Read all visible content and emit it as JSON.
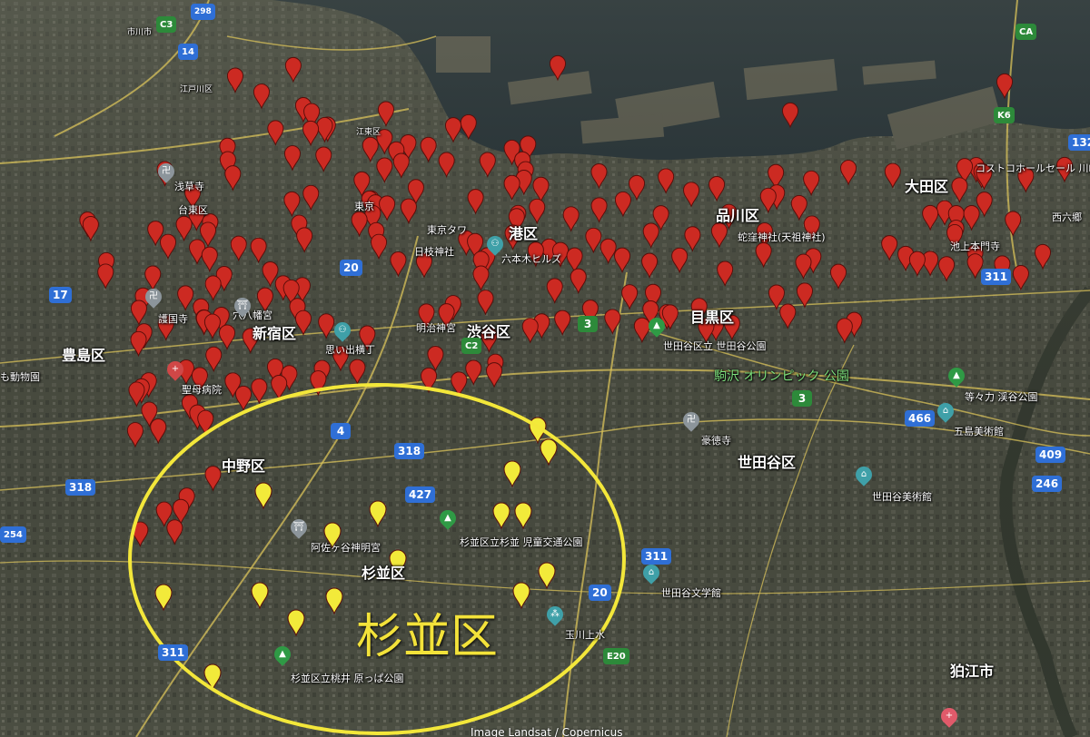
{
  "map": {
    "credit": "Image Landsat / Copernicus",
    "highlight_label": "杉並区",
    "colors": {
      "water": "#1d2b33",
      "land": "#4a4d40",
      "road": "#d8c25a",
      "red_pin": "#cc2a22",
      "yellow_pin": "#f2ea3a",
      "ellipse": "#f3e73a"
    }
  },
  "districts": [
    {
      "id": "toshima",
      "label": "豊島区"
    },
    {
      "id": "shinjuku",
      "label": "新宿区"
    },
    {
      "id": "shibuya",
      "label": "渋谷区"
    },
    {
      "id": "minato",
      "label": "港区"
    },
    {
      "id": "shinagawa",
      "label": "品川区"
    },
    {
      "id": "meguro",
      "label": "目黒区"
    },
    {
      "id": "ota",
      "label": "大田区"
    },
    {
      "id": "nakano",
      "label": "中野区"
    },
    {
      "id": "suginami",
      "label": "杉並区"
    },
    {
      "id": "setagaya",
      "label": "世田谷区"
    },
    {
      "id": "komae",
      "label": "狛江市"
    },
    {
      "id": "taito",
      "label": "台東区"
    }
  ],
  "pois": [
    {
      "id": "asakusa",
      "label": "浅草寺"
    },
    {
      "id": "tokyo",
      "label": "東京"
    },
    {
      "id": "tokyo-tower",
      "label": "東京タワ"
    },
    {
      "id": "hie",
      "label": "日枝神社"
    },
    {
      "id": "roppongi",
      "label": "六本木ヒルズ"
    },
    {
      "id": "gokokuji",
      "label": "護国寺"
    },
    {
      "id": "anahachiman",
      "label": "穴八幡宮"
    },
    {
      "id": "meiji",
      "label": "明治神宮"
    },
    {
      "id": "omoide",
      "label": "思い出横丁"
    },
    {
      "id": "seibo",
      "label": "聖母病院"
    },
    {
      "id": "dobutsu",
      "label": "も動物園"
    },
    {
      "id": "jatai",
      "label": "蛇窪神社(天祖神社)"
    },
    {
      "id": "ikegami",
      "label": "池上本門寺"
    },
    {
      "id": "costco",
      "label": "コストコホールセール 川崎"
    },
    {
      "id": "nishirokugo",
      "label": "西六郷"
    },
    {
      "id": "setagaya-park",
      "label": "世田谷区立 世田谷公園"
    },
    {
      "id": "komazawa",
      "label": "駒沢 オリンピック 公園"
    },
    {
      "id": "todoroki",
      "label": "等々力 渓谷公園"
    },
    {
      "id": "gotoh",
      "label": "五島美術館"
    },
    {
      "id": "gotokuji",
      "label": "豪徳寺"
    },
    {
      "id": "setagaya-museum",
      "label": "世田谷美術館"
    },
    {
      "id": "setagaya-lit",
      "label": "世田谷文学館"
    },
    {
      "id": "tamagawa",
      "label": "玉川上水"
    },
    {
      "id": "asagaya",
      "label": "阿佐ヶ谷神明宮"
    },
    {
      "id": "suginami-park",
      "label": "杉並区立杉並 児童交通公園"
    },
    {
      "id": "momoi",
      "label": "杉並区立桃井 原っぱ公園"
    },
    {
      "id": "edogawa",
      "label": "江戸川区"
    },
    {
      "id": "koto",
      "label": "江東区"
    },
    {
      "id": "ichikawa",
      "label": "市川市"
    }
  ],
  "routes": [
    {
      "id": "r17",
      "label": "17"
    },
    {
      "id": "r20a",
      "label": "20"
    },
    {
      "id": "r4",
      "label": "4"
    },
    {
      "id": "r318a",
      "label": "318"
    },
    {
      "id": "r318b",
      "label": "318"
    },
    {
      "id": "r427",
      "label": "427"
    },
    {
      "id": "r311a",
      "label": "311"
    },
    {
      "id": "r311b",
      "label": "311"
    },
    {
      "id": "r311c",
      "label": "311"
    },
    {
      "id": "r20b",
      "label": "20"
    },
    {
      "id": "r466",
      "label": "466"
    },
    {
      "id": "r409",
      "label": "409"
    },
    {
      "id": "r246",
      "label": "246"
    },
    {
      "id": "r3a",
      "label": "3"
    },
    {
      "id": "r3b",
      "label": "3"
    },
    {
      "id": "rc2",
      "label": "C2"
    },
    {
      "id": "re20",
      "label": "E20"
    },
    {
      "id": "rk6",
      "label": "K6"
    },
    {
      "id": "r132",
      "label": "132"
    },
    {
      "id": "r254",
      "label": "254"
    },
    {
      "id": "rc3",
      "label": "C3"
    },
    {
      "id": "r298",
      "label": "298"
    },
    {
      "id": "r14",
      "label": "14"
    },
    {
      "id": "rca",
      "label": "CA"
    }
  ]
}
